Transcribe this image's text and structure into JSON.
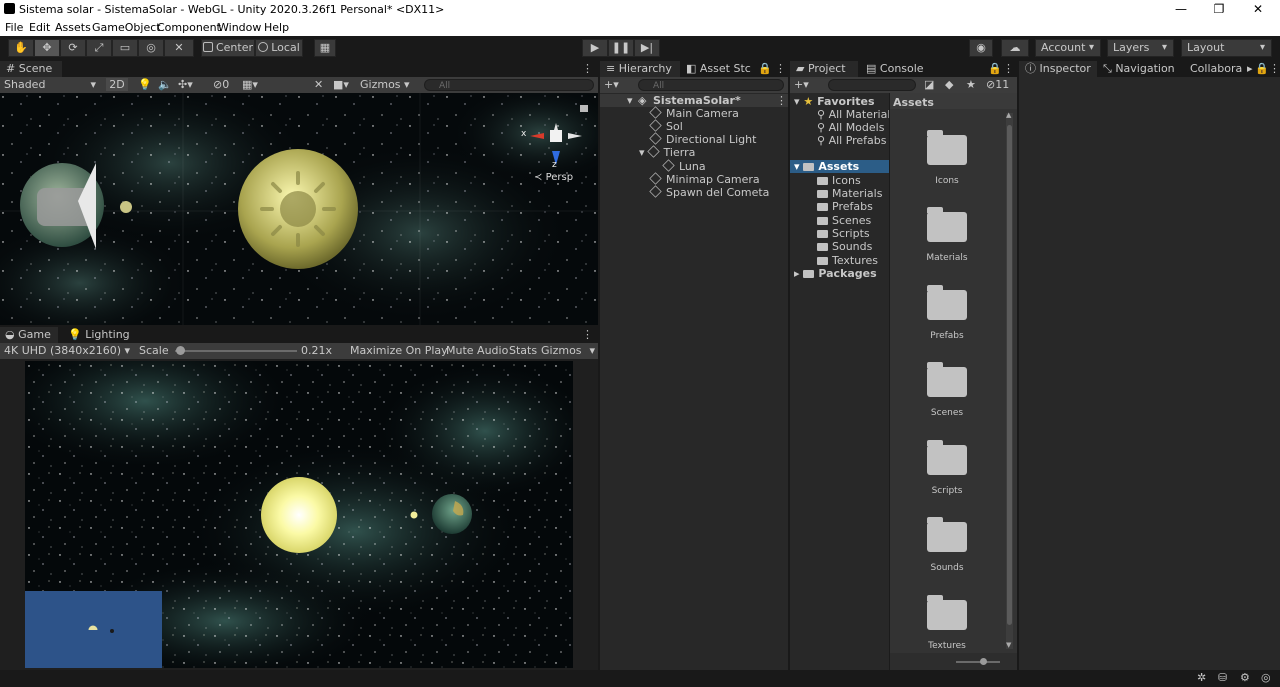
{
  "window": {
    "title": "Sistema solar - SistemaSolar - WebGL - Unity 2020.3.26f1 Personal* <DX11>",
    "min_glyph": "—",
    "max_glyph": "❐",
    "close_glyph": "✕"
  },
  "menu": [
    "File",
    "Edit",
    "Assets",
    "GameObject",
    "Component",
    "Window",
    "Help"
  ],
  "toolbar": {
    "pivot_label": "Center",
    "space_label": "Local",
    "account_label": "Account",
    "layers_label": "Layers",
    "layout_label": "Layout"
  },
  "scene": {
    "tab_label": "Scene",
    "shading_mode": "Shaded",
    "mode_2d": "2D",
    "hidden_count": "0",
    "gizmos_label": "Gizmos",
    "search_placeholder": "All",
    "persp_label": "Persp",
    "axis_x": "x",
    "axis_z": "z"
  },
  "game": {
    "tab_label": "Game",
    "lighting_tab": "Lighting",
    "resolution": "4K UHD (3840x2160)",
    "scale_label": "Scale",
    "scale_value": "0.21x",
    "scale_fraction": 0.04,
    "maximize_label": "Maximize On Play",
    "mute_label": "Mute Audio",
    "stats_label": "Stats",
    "gizmos_label": "Gizmos"
  },
  "hierarchy": {
    "tab_label": "Hierarchy",
    "asset_store_tab": "Asset Stc",
    "search_placeholder": "All",
    "scene_name": "SistemaSolar*",
    "items": [
      {
        "label": "Main Camera"
      },
      {
        "label": "Sol"
      },
      {
        "label": "Directional Light"
      },
      {
        "label": "Tierra"
      },
      {
        "label": "Luna"
      },
      {
        "label": "Minimap Camera"
      },
      {
        "label": "Spawn del Cometa"
      }
    ]
  },
  "project": {
    "tab_label": "Project",
    "console_tab": "Console",
    "hidden_count": "11",
    "favorites_label": "Favorites",
    "favorites": [
      "All Materials",
      "All Models",
      "All Prefabs"
    ],
    "assets_label": "Assets",
    "asset_folders": [
      "Icons",
      "Materials",
      "Prefabs",
      "Scenes",
      "Scripts",
      "Sounds",
      "Textures"
    ],
    "packages_label": "Packages",
    "content_header": "Assets",
    "grid_items": [
      "Icons",
      "Materials",
      "Prefabs",
      "Scenes",
      "Scripts",
      "Sounds",
      "Textures"
    ]
  },
  "inspector": {
    "tab_label": "Inspector",
    "navigation_tab": "Navigation",
    "collab_tab": "Collabora"
  },
  "colors": {
    "selection": "#2c5d87",
    "panel_bg": "#282828",
    "minimap_bg": "#2d5389",
    "sun": "#f3f28e"
  }
}
